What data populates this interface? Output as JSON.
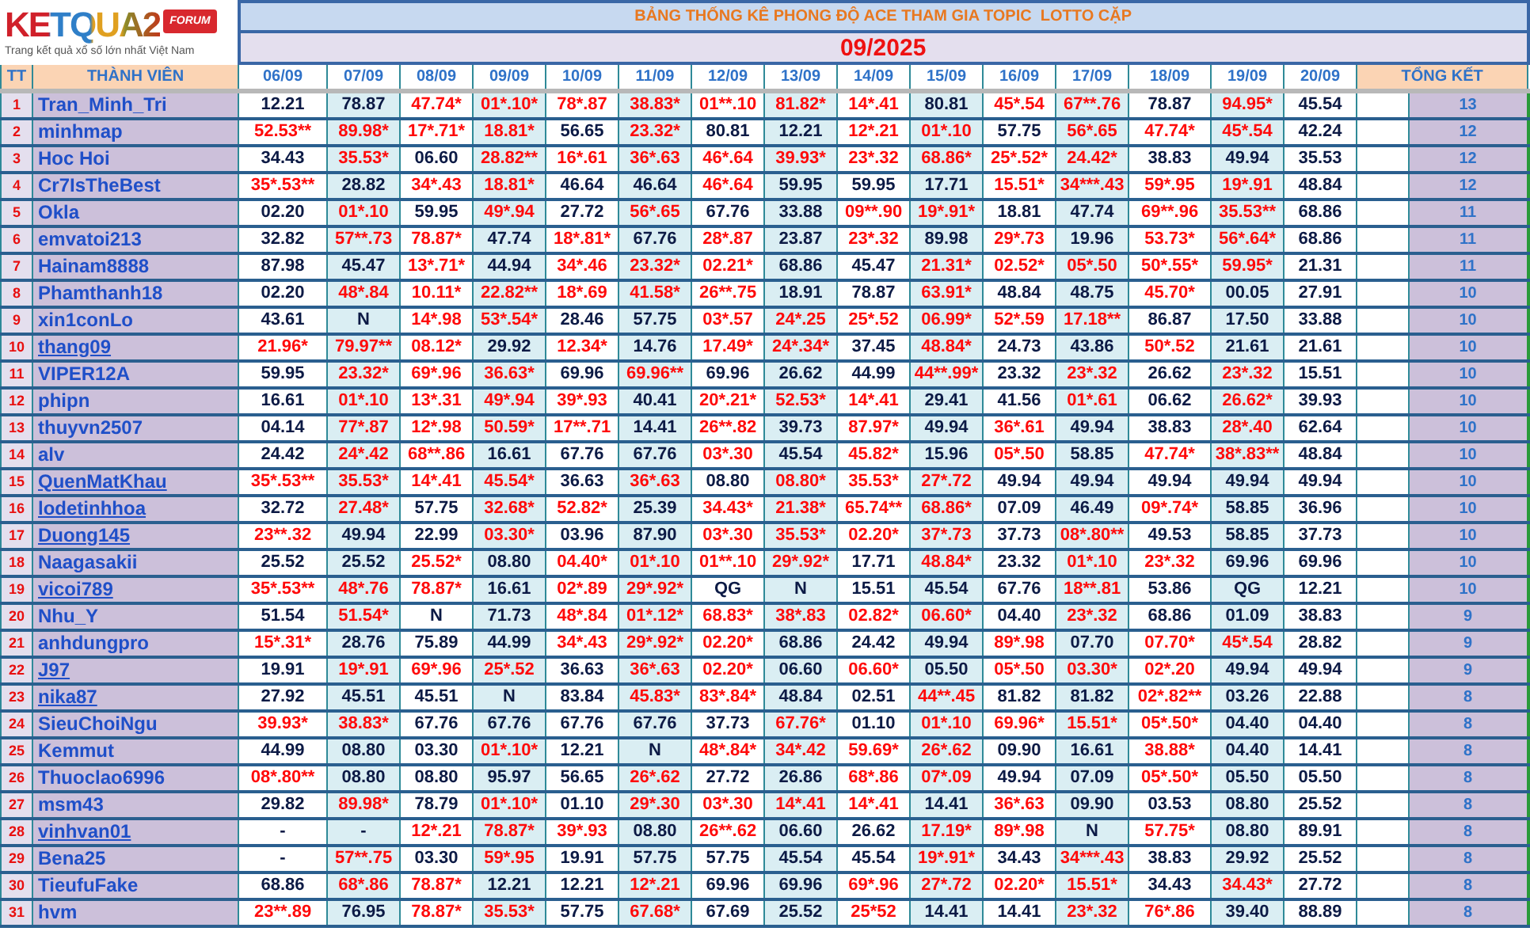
{
  "logo": {
    "wordmark": "KETQUA2",
    "badge": "FORUM",
    "tagline": "Trang kết quả xổ số lớn nhất Việt Nam"
  },
  "title": "BẢNG THỐNG KÊ PHONG ĐỘ ACE THAM GIA TOPIC  LOTTO CẶP",
  "month": "09/2025",
  "columns": {
    "index": "TT",
    "member": "THÀNH VIÊN",
    "dates": [
      "06/09",
      "07/09",
      "08/09",
      "09/09",
      "10/09",
      "11/09",
      "12/09",
      "13/09",
      "14/09",
      "15/09",
      "16/09",
      "17/09",
      "18/09",
      "19/09",
      "20/09"
    ],
    "total": "TỔNG KẾT"
  },
  "rows": [
    {
      "tt": "1",
      "name": "Tran_Minh_Tri",
      "underlined": false,
      "total": "13",
      "cells": [
        {
          "v": "12.21",
          "hit": false
        },
        {
          "v": "78.87",
          "hit": false
        },
        {
          "v": "47.74*",
          "hit": true
        },
        {
          "v": "01*.10*",
          "hit": true
        },
        {
          "v": "78*.87",
          "hit": true
        },
        {
          "v": "38.83*",
          "hit": true
        },
        {
          "v": "01**.10",
          "hit": true
        },
        {
          "v": "81.82*",
          "hit": true
        },
        {
          "v": "14*.41",
          "hit": true
        },
        {
          "v": "80.81",
          "hit": false
        },
        {
          "v": "45*.54",
          "hit": true
        },
        {
          "v": "67**.76",
          "hit": true
        },
        {
          "v": "78.87",
          "hit": false
        },
        {
          "v": "94.95*",
          "hit": true
        },
        {
          "v": "45.54",
          "hit": false
        }
      ]
    },
    {
      "tt": "2",
      "name": "minhmap",
      "underlined": false,
      "total": "12",
      "cells": [
        {
          "v": "52.53**",
          "hit": true
        },
        {
          "v": "89.98*",
          "hit": true
        },
        {
          "v": "17*.71*",
          "hit": true
        },
        {
          "v": "18.81*",
          "hit": true
        },
        {
          "v": "56.65",
          "hit": false
        },
        {
          "v": "23.32*",
          "hit": true
        },
        {
          "v": "80.81",
          "hit": false
        },
        {
          "v": "12.21",
          "hit": false
        },
        {
          "v": "12*.21",
          "hit": true
        },
        {
          "v": "01*.10",
          "hit": true
        },
        {
          "v": "57.75",
          "hit": false
        },
        {
          "v": "56*.65",
          "hit": true
        },
        {
          "v": "47.74*",
          "hit": true
        },
        {
          "v": "45*.54",
          "hit": true
        },
        {
          "v": "42.24",
          "hit": false
        }
      ]
    },
    {
      "tt": "3",
      "name": "Hoc Hoi",
      "underlined": false,
      "total": "12",
      "cells": [
        {
          "v": "34.43",
          "hit": false
        },
        {
          "v": "35.53*",
          "hit": true
        },
        {
          "v": "06.60",
          "hit": false
        },
        {
          "v": "28.82**",
          "hit": true
        },
        {
          "v": "16*.61",
          "hit": true
        },
        {
          "v": "36*.63",
          "hit": true
        },
        {
          "v": "46*.64",
          "hit": true
        },
        {
          "v": "39.93*",
          "hit": true
        },
        {
          "v": "23*.32",
          "hit": true
        },
        {
          "v": "68.86*",
          "hit": true
        },
        {
          "v": "25*.52*",
          "hit": true
        },
        {
          "v": "24.42*",
          "hit": true
        },
        {
          "v": "38.83",
          "hit": false
        },
        {
          "v": "49.94",
          "hit": false
        },
        {
          "v": "35.53",
          "hit": false
        }
      ]
    },
    {
      "tt": "4",
      "name": "Cr7IsTheBest",
      "underlined": false,
      "total": "12",
      "cells": [
        {
          "v": "35*.53**",
          "hit": true
        },
        {
          "v": "28.82",
          "hit": false
        },
        {
          "v": "34*.43",
          "hit": true
        },
        {
          "v": "18.81*",
          "hit": true
        },
        {
          "v": "46.64",
          "hit": false
        },
        {
          "v": "46.64",
          "hit": false
        },
        {
          "v": "46*.64",
          "hit": true
        },
        {
          "v": "59.95",
          "hit": false
        },
        {
          "v": "59.95",
          "hit": false
        },
        {
          "v": "17.71",
          "hit": false
        },
        {
          "v": "15.51*",
          "hit": true
        },
        {
          "v": "34***.43",
          "hit": true
        },
        {
          "v": "59*.95",
          "hit": true
        },
        {
          "v": "19*.91",
          "hit": true
        },
        {
          "v": "48.84",
          "hit": false
        }
      ]
    },
    {
      "tt": "5",
      "name": "Okla",
      "underlined": false,
      "total": "11",
      "cells": [
        {
          "v": "02.20",
          "hit": false
        },
        {
          "v": "01*.10",
          "hit": true
        },
        {
          "v": "59.95",
          "hit": false
        },
        {
          "v": "49*.94",
          "hit": true
        },
        {
          "v": "27.72",
          "hit": false
        },
        {
          "v": "56*.65",
          "hit": true
        },
        {
          "v": "67.76",
          "hit": false
        },
        {
          "v": "33.88",
          "hit": false
        },
        {
          "v": "09**.90",
          "hit": true
        },
        {
          "v": "19*.91*",
          "hit": true
        },
        {
          "v": "18.81",
          "hit": false
        },
        {
          "v": "47.74",
          "hit": false
        },
        {
          "v": "69**.96",
          "hit": true
        },
        {
          "v": "35.53**",
          "hit": true
        },
        {
          "v": "68.86",
          "hit": false
        }
      ]
    },
    {
      "tt": "6",
      "name": "emvatoi213",
      "underlined": false,
      "total": "11",
      "cells": [
        {
          "v": "32.82",
          "hit": false
        },
        {
          "v": "57**.73",
          "hit": true
        },
        {
          "v": "78.87*",
          "hit": true
        },
        {
          "v": "47.74",
          "hit": false
        },
        {
          "v": "18*.81*",
          "hit": true
        },
        {
          "v": "67.76",
          "hit": false
        },
        {
          "v": "28*.87",
          "hit": true
        },
        {
          "v": "23.87",
          "hit": false
        },
        {
          "v": "23*.32",
          "hit": true
        },
        {
          "v": "89.98",
          "hit": false
        },
        {
          "v": "29*.73",
          "hit": true
        },
        {
          "v": "19.96",
          "hit": false
        },
        {
          "v": "53.73*",
          "hit": true
        },
        {
          "v": "56*.64*",
          "hit": true
        },
        {
          "v": "68.86",
          "hit": false
        }
      ]
    },
    {
      "tt": "7",
      "name": "Hainam8888",
      "underlined": false,
      "total": "11",
      "cells": [
        {
          "v": "87.98",
          "hit": false
        },
        {
          "v": "45.47",
          "hit": false
        },
        {
          "v": "13*.71*",
          "hit": true
        },
        {
          "v": "44.94",
          "hit": false
        },
        {
          "v": "34*.46",
          "hit": true
        },
        {
          "v": "23.32*",
          "hit": true
        },
        {
          "v": "02.21*",
          "hit": true
        },
        {
          "v": "68.86",
          "hit": false
        },
        {
          "v": "45.47",
          "hit": false
        },
        {
          "v": "21.31*",
          "hit": true
        },
        {
          "v": "02.52*",
          "hit": true
        },
        {
          "v": "05*.50",
          "hit": true
        },
        {
          "v": "50*.55*",
          "hit": true
        },
        {
          "v": "59.95*",
          "hit": true
        },
        {
          "v": "21.31",
          "hit": false
        }
      ]
    },
    {
      "tt": "8",
      "name": "Phamthanh18",
      "underlined": false,
      "total": "10",
      "cells": [
        {
          "v": "02.20",
          "hit": false
        },
        {
          "v": "48*.84",
          "hit": true
        },
        {
          "v": "10.11*",
          "hit": true
        },
        {
          "v": "22.82**",
          "hit": true
        },
        {
          "v": "18*.69",
          "hit": true
        },
        {
          "v": "41.58*",
          "hit": true
        },
        {
          "v": "26**.75",
          "hit": true
        },
        {
          "v": "18.91",
          "hit": false
        },
        {
          "v": "78.87",
          "hit": false
        },
        {
          "v": "63.91*",
          "hit": true
        },
        {
          "v": "48.84",
          "hit": false
        },
        {
          "v": "48.75",
          "hit": false
        },
        {
          "v": "45.70*",
          "hit": true
        },
        {
          "v": "00.05",
          "hit": false
        },
        {
          "v": "27.91",
          "hit": false
        }
      ]
    },
    {
      "tt": "9",
      "name": "xin1conLo",
      "underlined": false,
      "total": "10",
      "cells": [
        {
          "v": "43.61",
          "hit": false
        },
        {
          "v": "N",
          "hit": false
        },
        {
          "v": "14*.98",
          "hit": true
        },
        {
          "v": "53*.54*",
          "hit": true
        },
        {
          "v": "28.46",
          "hit": false
        },
        {
          "v": "57.75",
          "hit": false
        },
        {
          "v": "03*.57",
          "hit": true
        },
        {
          "v": "24*.25",
          "hit": true
        },
        {
          "v": "25*.52",
          "hit": true
        },
        {
          "v": "06.99*",
          "hit": true
        },
        {
          "v": "52*.59",
          "hit": true
        },
        {
          "v": "17.18**",
          "hit": true
        },
        {
          "v": "86.87",
          "hit": false
        },
        {
          "v": "17.50",
          "hit": false
        },
        {
          "v": "33.88",
          "hit": false
        }
      ]
    },
    {
      "tt": "10",
      "name": "thang09",
      "underlined": true,
      "total": "10",
      "cells": [
        {
          "v": "21.96*",
          "hit": true
        },
        {
          "v": "79.97**",
          "hit": true
        },
        {
          "v": "08.12*",
          "hit": true
        },
        {
          "v": "29.92",
          "hit": false
        },
        {
          "v": "12.34*",
          "hit": true
        },
        {
          "v": "14.76",
          "hit": false
        },
        {
          "v": "17.49*",
          "hit": true
        },
        {
          "v": "24*.34*",
          "hit": true
        },
        {
          "v": "37.45",
          "hit": false
        },
        {
          "v": "48.84*",
          "hit": true
        },
        {
          "v": "24.73",
          "hit": false
        },
        {
          "v": "43.86",
          "hit": false
        },
        {
          "v": "50*.52",
          "hit": true
        },
        {
          "v": "21.61",
          "hit": false
        },
        {
          "v": "21.61",
          "hit": false
        }
      ]
    },
    {
      "tt": "11",
      "name": "VIPER12A",
      "underlined": false,
      "total": "10",
      "cells": [
        {
          "v": "59.95",
          "hit": false
        },
        {
          "v": "23.32*",
          "hit": true
        },
        {
          "v": "69*.96",
          "hit": true
        },
        {
          "v": "36.63*",
          "hit": true
        },
        {
          "v": "69.96",
          "hit": false
        },
        {
          "v": "69.96**",
          "hit": true
        },
        {
          "v": "69.96",
          "hit": false
        },
        {
          "v": "26.62",
          "hit": false
        },
        {
          "v": "44.99",
          "hit": false
        },
        {
          "v": "44**.99*",
          "hit": true
        },
        {
          "v": "23.32",
          "hit": false
        },
        {
          "v": "23*.32",
          "hit": true
        },
        {
          "v": "26.62",
          "hit": false
        },
        {
          "v": "23*.32",
          "hit": true
        },
        {
          "v": "15.51",
          "hit": false
        }
      ]
    },
    {
      "tt": "12",
      "name": "phipn",
      "underlined": false,
      "total": "10",
      "cells": [
        {
          "v": "16.61",
          "hit": false
        },
        {
          "v": "01*.10",
          "hit": true
        },
        {
          "v": "13*.31",
          "hit": true
        },
        {
          "v": "49*.94",
          "hit": true
        },
        {
          "v": "39*.93",
          "hit": true
        },
        {
          "v": "40.41",
          "hit": false
        },
        {
          "v": "20*.21*",
          "hit": true
        },
        {
          "v": "52.53*",
          "hit": true
        },
        {
          "v": "14*.41",
          "hit": true
        },
        {
          "v": "29.41",
          "hit": false
        },
        {
          "v": "41.56",
          "hit": false
        },
        {
          "v": "01*.61",
          "hit": true
        },
        {
          "v": "06.62",
          "hit": false
        },
        {
          "v": "26.62*",
          "hit": true
        },
        {
          "v": "39.93",
          "hit": false
        }
      ]
    },
    {
      "tt": "13",
      "name": "thuyvn2507",
      "underlined": false,
      "total": "10",
      "cells": [
        {
          "v": "04.14",
          "hit": false
        },
        {
          "v": "77*.87",
          "hit": true
        },
        {
          "v": "12*.98",
          "hit": true
        },
        {
          "v": "50.59*",
          "hit": true
        },
        {
          "v": "17**.71",
          "hit": true
        },
        {
          "v": "14.41",
          "hit": false
        },
        {
          "v": "26**.82",
          "hit": true
        },
        {
          "v": "39.73",
          "hit": false
        },
        {
          "v": "87.97*",
          "hit": true
        },
        {
          "v": "49.94",
          "hit": false
        },
        {
          "v": "36*.61",
          "hit": true
        },
        {
          "v": "49.94",
          "hit": false
        },
        {
          "v": "38.83",
          "hit": false
        },
        {
          "v": "28*.40",
          "hit": true
        },
        {
          "v": "62.64",
          "hit": false
        }
      ]
    },
    {
      "tt": "14",
      "name": "alv",
      "underlined": false,
      "total": "10",
      "cells": [
        {
          "v": "24.42",
          "hit": false
        },
        {
          "v": "24*.42",
          "hit": true
        },
        {
          "v": "68**.86",
          "hit": true
        },
        {
          "v": "16.61",
          "hit": false
        },
        {
          "v": "67.76",
          "hit": false
        },
        {
          "v": "67.76",
          "hit": false
        },
        {
          "v": "03*.30",
          "hit": true
        },
        {
          "v": "45.54",
          "hit": false
        },
        {
          "v": "45.82*",
          "hit": true
        },
        {
          "v": "15.96",
          "hit": false
        },
        {
          "v": "05*.50",
          "hit": true
        },
        {
          "v": "58.85",
          "hit": false
        },
        {
          "v": "47.74*",
          "hit": true
        },
        {
          "v": "38*.83**",
          "hit": true
        },
        {
          "v": "48.84",
          "hit": false
        }
      ]
    },
    {
      "tt": "15",
      "name": "QuenMatKhau",
      "underlined": true,
      "total": "10",
      "cells": [
        {
          "v": "35*.53**",
          "hit": true
        },
        {
          "v": "35.53*",
          "hit": true
        },
        {
          "v": "14*.41",
          "hit": true
        },
        {
          "v": "45.54*",
          "hit": true
        },
        {
          "v": "36.63",
          "hit": false
        },
        {
          "v": "36*.63",
          "hit": true
        },
        {
          "v": "08.80",
          "hit": false
        },
        {
          "v": "08.80*",
          "hit": true
        },
        {
          "v": "35.53*",
          "hit": true
        },
        {
          "v": "27*.72",
          "hit": true
        },
        {
          "v": "49.94",
          "hit": false
        },
        {
          "v": "49.94",
          "hit": false
        },
        {
          "v": "49.94",
          "hit": false
        },
        {
          "v": "49.94",
          "hit": false
        },
        {
          "v": "49.94",
          "hit": false
        }
      ]
    },
    {
      "tt": "16",
      "name": "lodetinhhoa",
      "underlined": true,
      "total": "10",
      "cells": [
        {
          "v": "32.72",
          "hit": false
        },
        {
          "v": "27.48*",
          "hit": true
        },
        {
          "v": "57.75",
          "hit": false
        },
        {
          "v": "32.68*",
          "hit": true
        },
        {
          "v": "52.82*",
          "hit": true
        },
        {
          "v": "25.39",
          "hit": false
        },
        {
          "v": "34.43*",
          "hit": true
        },
        {
          "v": "21.38*",
          "hit": true
        },
        {
          "v": "65.74**",
          "hit": true
        },
        {
          "v": "68.86*",
          "hit": true
        },
        {
          "v": "07.09",
          "hit": false
        },
        {
          "v": "46.49",
          "hit": false
        },
        {
          "v": "09*.74*",
          "hit": true
        },
        {
          "v": "58.85",
          "hit": false
        },
        {
          "v": "36.96",
          "hit": false
        }
      ]
    },
    {
      "tt": "17",
      "name": "Duong145",
      "underlined": true,
      "total": "10",
      "cells": [
        {
          "v": "23**.32",
          "hit": true
        },
        {
          "v": "49.94",
          "hit": false
        },
        {
          "v": "22.99",
          "hit": false
        },
        {
          "v": "03.30*",
          "hit": true
        },
        {
          "v": "03.96",
          "hit": false
        },
        {
          "v": "87.90",
          "hit": false
        },
        {
          "v": "03*.30",
          "hit": true
        },
        {
          "v": "35.53*",
          "hit": true
        },
        {
          "v": "02.20*",
          "hit": true
        },
        {
          "v": "37*.73",
          "hit": true
        },
        {
          "v": "37.73",
          "hit": false
        },
        {
          "v": "08*.80**",
          "hit": true
        },
        {
          "v": "49.53",
          "hit": false
        },
        {
          "v": "58.85",
          "hit": false
        },
        {
          "v": "37.73",
          "hit": false
        }
      ]
    },
    {
      "tt": "18",
      "name": "Naagasakii",
      "underlined": false,
      "total": "10",
      "cells": [
        {
          "v": "25.52",
          "hit": false
        },
        {
          "v": "25.52",
          "hit": false
        },
        {
          "v": "25.52*",
          "hit": true
        },
        {
          "v": "08.80",
          "hit": false
        },
        {
          "v": "04.40*",
          "hit": true
        },
        {
          "v": "01*.10",
          "hit": true
        },
        {
          "v": "01**.10",
          "hit": true
        },
        {
          "v": "29*.92*",
          "hit": true
        },
        {
          "v": "17.71",
          "hit": false
        },
        {
          "v": "48.84*",
          "hit": true
        },
        {
          "v": "23.32",
          "hit": false
        },
        {
          "v": "01*.10",
          "hit": true
        },
        {
          "v": "23*.32",
          "hit": true
        },
        {
          "v": "69.96",
          "hit": false
        },
        {
          "v": "69.96",
          "hit": false
        }
      ]
    },
    {
      "tt": "19",
      "name": "vicoi789",
      "underlined": true,
      "total": "10",
      "cells": [
        {
          "v": "35*.53**",
          "hit": true
        },
        {
          "v": "48*.76",
          "hit": true
        },
        {
          "v": "78.87*",
          "hit": true
        },
        {
          "v": "16.61",
          "hit": false
        },
        {
          "v": "02*.89",
          "hit": true
        },
        {
          "v": "29*.92*",
          "hit": true
        },
        {
          "v": "QG",
          "hit": false
        },
        {
          "v": "N",
          "hit": false
        },
        {
          "v": "15.51",
          "hit": false
        },
        {
          "v": "45.54",
          "hit": false
        },
        {
          "v": "67.76",
          "hit": false
        },
        {
          "v": "18**.81",
          "hit": true
        },
        {
          "v": "53.86",
          "hit": false
        },
        {
          "v": "QG",
          "hit": false
        },
        {
          "v": "12.21",
          "hit": false
        }
      ]
    },
    {
      "tt": "20",
      "name": "Nhu_Y",
      "underlined": false,
      "total": "9",
      "cells": [
        {
          "v": "51.54",
          "hit": false
        },
        {
          "v": "51.54*",
          "hit": true
        },
        {
          "v": "N",
          "hit": false
        },
        {
          "v": "71.73",
          "hit": false
        },
        {
          "v": "48*.84",
          "hit": true
        },
        {
          "v": "01*.12*",
          "hit": true
        },
        {
          "v": "68.83*",
          "hit": true
        },
        {
          "v": "38*.83",
          "hit": true
        },
        {
          "v": "02.82*",
          "hit": true
        },
        {
          "v": "06.60*",
          "hit": true
        },
        {
          "v": "04.40",
          "hit": false
        },
        {
          "v": "23*.32",
          "hit": true
        },
        {
          "v": "68.86",
          "hit": false
        },
        {
          "v": "01.09",
          "hit": false
        },
        {
          "v": "38.83",
          "hit": false
        }
      ]
    },
    {
      "tt": "21",
      "name": "anhdungpro",
      "underlined": false,
      "total": "9",
      "cells": [
        {
          "v": "15*.31*",
          "hit": true
        },
        {
          "v": "28.76",
          "hit": false
        },
        {
          "v": "75.89",
          "hit": false
        },
        {
          "v": "44.99",
          "hit": false
        },
        {
          "v": "34*.43",
          "hit": true
        },
        {
          "v": "29*.92*",
          "hit": true
        },
        {
          "v": "02.20*",
          "hit": true
        },
        {
          "v": "68.86",
          "hit": false
        },
        {
          "v": "24.42",
          "hit": false
        },
        {
          "v": "49.94",
          "hit": false
        },
        {
          "v": "89*.98",
          "hit": true
        },
        {
          "v": "07.70",
          "hit": false
        },
        {
          "v": "07.70*",
          "hit": true
        },
        {
          "v": "45*.54",
          "hit": true
        },
        {
          "v": "28.82",
          "hit": false
        }
      ]
    },
    {
      "tt": "22",
      "name": "J97",
      "underlined": true,
      "total": "9",
      "cells": [
        {
          "v": "19.91",
          "hit": false
        },
        {
          "v": "19*.91",
          "hit": true
        },
        {
          "v": "69*.96",
          "hit": true
        },
        {
          "v": "25*.52",
          "hit": true
        },
        {
          "v": "36.63",
          "hit": false
        },
        {
          "v": "36*.63",
          "hit": true
        },
        {
          "v": "02.20*",
          "hit": true
        },
        {
          "v": "06.60",
          "hit": false
        },
        {
          "v": "06.60*",
          "hit": true
        },
        {
          "v": "05.50",
          "hit": false
        },
        {
          "v": "05*.50",
          "hit": true
        },
        {
          "v": "03.30*",
          "hit": true
        },
        {
          "v": "02*.20",
          "hit": true
        },
        {
          "v": "49.94",
          "hit": false
        },
        {
          "v": "49.94",
          "hit": false
        }
      ]
    },
    {
      "tt": "23",
      "name": "nika87",
      "underlined": true,
      "total": "8",
      "cells": [
        {
          "v": "27.92",
          "hit": false
        },
        {
          "v": "45.51",
          "hit": false
        },
        {
          "v": "45.51",
          "hit": false
        },
        {
          "v": "N",
          "hit": false
        },
        {
          "v": "83.84",
          "hit": false
        },
        {
          "v": "45.83*",
          "hit": true
        },
        {
          "v": "83*.84*",
          "hit": true
        },
        {
          "v": "48.84",
          "hit": false
        },
        {
          "v": "02.51",
          "hit": false
        },
        {
          "v": "44**.45",
          "hit": true
        },
        {
          "v": "81.82",
          "hit": false
        },
        {
          "v": "81.82",
          "hit": false
        },
        {
          "v": "02*.82**",
          "hit": true
        },
        {
          "v": "03.26",
          "hit": false
        },
        {
          "v": "22.88",
          "hit": false
        }
      ]
    },
    {
      "tt": "24",
      "name": "SieuChoiNgu",
      "underlined": false,
      "total": "8",
      "cells": [
        {
          "v": "39.93*",
          "hit": true
        },
        {
          "v": "38.83*",
          "hit": true
        },
        {
          "v": "67.76",
          "hit": false
        },
        {
          "v": "67.76",
          "hit": false
        },
        {
          "v": "67.76",
          "hit": false
        },
        {
          "v": "67.76",
          "hit": false
        },
        {
          "v": "37.73",
          "hit": false
        },
        {
          "v": "67.76*",
          "hit": true
        },
        {
          "v": "01.10",
          "hit": false
        },
        {
          "v": "01*.10",
          "hit": true
        },
        {
          "v": "69.96*",
          "hit": true
        },
        {
          "v": "15.51*",
          "hit": true
        },
        {
          "v": "05*.50*",
          "hit": true
        },
        {
          "v": "04.40",
          "hit": false
        },
        {
          "v": "04.40",
          "hit": false
        }
      ]
    },
    {
      "tt": "25",
      "name": "Kemmut",
      "underlined": false,
      "total": "8",
      "cells": [
        {
          "v": "44.99",
          "hit": false
        },
        {
          "v": "08.80",
          "hit": false
        },
        {
          "v": "03.30",
          "hit": false
        },
        {
          "v": "01*.10*",
          "hit": true
        },
        {
          "v": "12.21",
          "hit": false
        },
        {
          "v": "N",
          "hit": false
        },
        {
          "v": "48*.84*",
          "hit": true
        },
        {
          "v": "34*.42",
          "hit": true
        },
        {
          "v": "59.69*",
          "hit": true
        },
        {
          "v": "26*.62",
          "hit": true
        },
        {
          "v": "09.90",
          "hit": false
        },
        {
          "v": "16.61",
          "hit": false
        },
        {
          "v": "38.88*",
          "hit": true
        },
        {
          "v": "04.40",
          "hit": false
        },
        {
          "v": "14.41",
          "hit": false
        }
      ]
    },
    {
      "tt": "26",
      "name": "Thuoclao6996",
      "underlined": false,
      "total": "8",
      "cells": [
        {
          "v": "08*.80**",
          "hit": true
        },
        {
          "v": "08.80",
          "hit": false
        },
        {
          "v": "08.80",
          "hit": false
        },
        {
          "v": "95.97",
          "hit": false
        },
        {
          "v": "56.65",
          "hit": false
        },
        {
          "v": "26*.62",
          "hit": true
        },
        {
          "v": "27.72",
          "hit": false
        },
        {
          "v": "26.86",
          "hit": false
        },
        {
          "v": "68*.86",
          "hit": true
        },
        {
          "v": "07*.09",
          "hit": true
        },
        {
          "v": "49.94",
          "hit": false
        },
        {
          "v": "07.09",
          "hit": false
        },
        {
          "v": "05*.50*",
          "hit": true
        },
        {
          "v": "05.50",
          "hit": false
        },
        {
          "v": "05.50",
          "hit": false
        }
      ]
    },
    {
      "tt": "27",
      "name": "msm43",
      "underlined": false,
      "total": "8",
      "cells": [
        {
          "v": "29.82",
          "hit": false
        },
        {
          "v": "89.98*",
          "hit": true
        },
        {
          "v": "78.79",
          "hit": false
        },
        {
          "v": "01*.10*",
          "hit": true
        },
        {
          "v": "01.10",
          "hit": false
        },
        {
          "v": "29*.30",
          "hit": true
        },
        {
          "v": "03*.30",
          "hit": true
        },
        {
          "v": "14*.41",
          "hit": true
        },
        {
          "v": "14*.41",
          "hit": true
        },
        {
          "v": "14.41",
          "hit": false
        },
        {
          "v": "36*.63",
          "hit": true
        },
        {
          "v": "09.90",
          "hit": false
        },
        {
          "v": "03.53",
          "hit": false
        },
        {
          "v": "08.80",
          "hit": false
        },
        {
          "v": "25.52",
          "hit": false
        }
      ]
    },
    {
      "tt": "28",
      "name": "vinhvan01",
      "underlined": true,
      "total": "8",
      "cells": [
        {
          "v": "-",
          "hit": false
        },
        {
          "v": "-",
          "hit": false
        },
        {
          "v": "12*.21",
          "hit": true
        },
        {
          "v": "78.87*",
          "hit": true
        },
        {
          "v": "39*.93",
          "hit": true
        },
        {
          "v": "08.80",
          "hit": false
        },
        {
          "v": "26**.62",
          "hit": true
        },
        {
          "v": "06.60",
          "hit": false
        },
        {
          "v": "26.62",
          "hit": false
        },
        {
          "v": "17.19*",
          "hit": true
        },
        {
          "v": "89*.98",
          "hit": true
        },
        {
          "v": "N",
          "hit": false
        },
        {
          "v": "57.75*",
          "hit": true
        },
        {
          "v": "08.80",
          "hit": false
        },
        {
          "v": "89.91",
          "hit": false
        }
      ]
    },
    {
      "tt": "29",
      "name": "Bena25",
      "underlined": false,
      "total": "8",
      "cells": [
        {
          "v": "-",
          "hit": false
        },
        {
          "v": "57**.75",
          "hit": true
        },
        {
          "v": "03.30",
          "hit": false
        },
        {
          "v": "59*.95",
          "hit": true
        },
        {
          "v": "19.91",
          "hit": false
        },
        {
          "v": "57.75",
          "hit": false
        },
        {
          "v": "57.75",
          "hit": false
        },
        {
          "v": "45.54",
          "hit": false
        },
        {
          "v": "45.54",
          "hit": false
        },
        {
          "v": "19*.91*",
          "hit": true
        },
        {
          "v": "34.43",
          "hit": false
        },
        {
          "v": "34***.43",
          "hit": true
        },
        {
          "v": "38.83",
          "hit": false
        },
        {
          "v": "29.92",
          "hit": false
        },
        {
          "v": "25.52",
          "hit": false
        }
      ]
    },
    {
      "tt": "30",
      "name": "TieufuFake",
      "underlined": false,
      "total": "8",
      "cells": [
        {
          "v": "68.86",
          "hit": false
        },
        {
          "v": "68*.86",
          "hit": true
        },
        {
          "v": "78.87*",
          "hit": true
        },
        {
          "v": "12.21",
          "hit": false
        },
        {
          "v": "12.21",
          "hit": false
        },
        {
          "v": "12*.21",
          "hit": true
        },
        {
          "v": "69.96",
          "hit": false
        },
        {
          "v": "69.96",
          "hit": false
        },
        {
          "v": "69*.96",
          "hit": true
        },
        {
          "v": "27*.72",
          "hit": true
        },
        {
          "v": "02.20*",
          "hit": true
        },
        {
          "v": "15.51*",
          "hit": true
        },
        {
          "v": "34.43",
          "hit": false
        },
        {
          "v": "34.43*",
          "hit": true
        },
        {
          "v": "27.72",
          "hit": false
        }
      ]
    },
    {
      "tt": "31",
      "name": "hvm",
      "underlined": false,
      "total": "8",
      "cells": [
        {
          "v": "23**.89",
          "hit": true
        },
        {
          "v": "76.95",
          "hit": false
        },
        {
          "v": "78.87*",
          "hit": true
        },
        {
          "v": "35.53*",
          "hit": true
        },
        {
          "v": "57.75",
          "hit": false
        },
        {
          "v": "67.68*",
          "hit": true
        },
        {
          "v": "67.69",
          "hit": false
        },
        {
          "v": "25.52",
          "hit": false
        },
        {
          "v": "25*52",
          "hit": true
        },
        {
          "v": "14.41",
          "hit": false
        },
        {
          "v": "14.41",
          "hit": false
        },
        {
          "v": "23*.32",
          "hit": true
        },
        {
          "v": "76*.86",
          "hit": true
        },
        {
          "v": "39.40",
          "hit": false
        },
        {
          "v": "88.89",
          "hit": false
        }
      ]
    }
  ]
}
